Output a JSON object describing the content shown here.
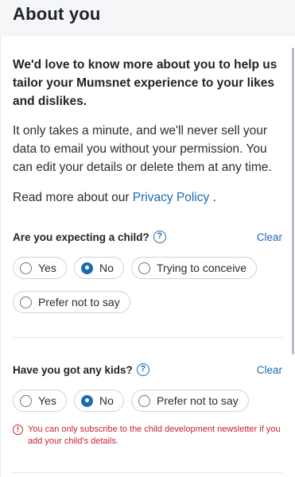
{
  "header": {
    "title": "About you"
  },
  "intro": {
    "bold": "We'd love to know more about you to help us tailor your Mumsnet experience to your likes and dislikes.",
    "text": "It only takes a minute, and we'll never sell your data to email you without your permission. You can edit your details or delete them at any time.",
    "read_more_prefix": "Read more about our ",
    "privacy_link": "Privacy Policy",
    "read_more_suffix": " ."
  },
  "questions": [
    {
      "label": "Are you expecting a child?",
      "help": "?",
      "clear": "Clear",
      "options": [
        "Yes",
        "No",
        "Trying to conceive",
        "Prefer not to say"
      ],
      "selected": "No"
    },
    {
      "label": "Have you got any kids?",
      "help": "?",
      "clear": "Clear",
      "options": [
        "Yes",
        "No",
        "Prefer not to say"
      ],
      "selected": "No"
    }
  ],
  "error": {
    "icon": "!",
    "message": "You can only subscribe to the child development newsletter if you add your child's details."
  },
  "colors": {
    "accent": "#1c6bb0",
    "error": "#c8232b"
  }
}
